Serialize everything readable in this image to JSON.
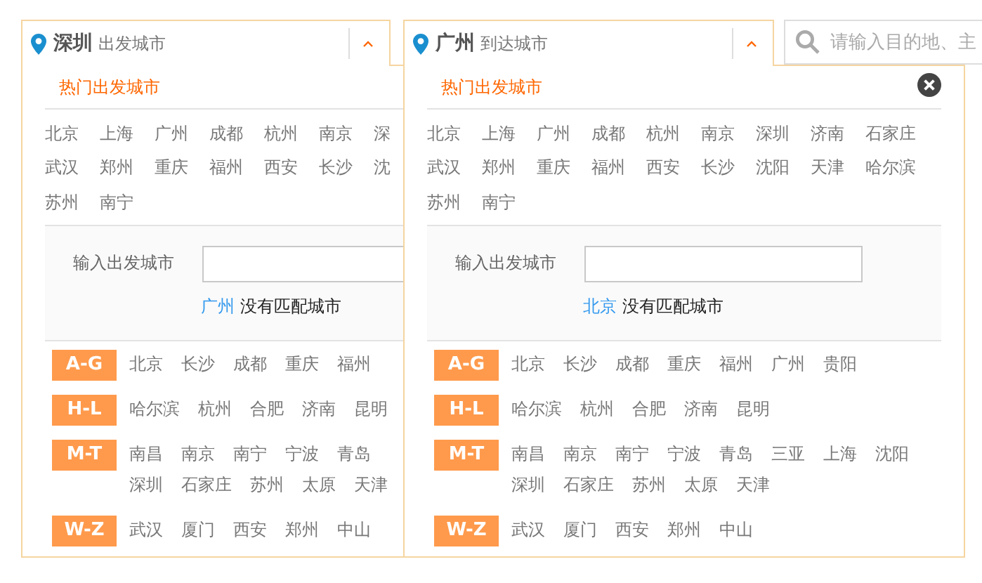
{
  "panels": [
    {
      "city": "深圳",
      "label": "出发城市",
      "expanded": true,
      "close_button": false,
      "hot_title": "热门出发城市",
      "hot_rows": [
        [
          "北京",
          "上海",
          "广州",
          "成都",
          "杭州",
          "南京",
          "深"
        ],
        [
          "武汉",
          "郑州",
          "重庆",
          "福州",
          "西安",
          "长沙",
          "沈"
        ],
        [
          "苏州",
          "南宁"
        ]
      ],
      "input_label": "输入出发城市",
      "no_match": {
        "city": "广州",
        "text": "没有匹配城市"
      },
      "groups": [
        {
          "range": "A-G",
          "lines": [
            [
              "北京",
              "长沙",
              "成都",
              "重庆",
              "福州"
            ]
          ]
        },
        {
          "range": "H-L",
          "lines": [
            [
              "哈尔滨",
              "杭州",
              "合肥",
              "济南",
              "昆明"
            ]
          ]
        },
        {
          "range": "M-T",
          "lines": [
            [
              "南昌",
              "南京",
              "南宁",
              "宁波",
              "青岛"
            ],
            [
              "深圳",
              "石家庄",
              "苏州",
              "太原",
              "天津"
            ]
          ]
        },
        {
          "range": "W-Z",
          "lines": [
            [
              "武汉",
              "厦门",
              "西安",
              "郑州",
              "中山"
            ]
          ]
        }
      ]
    },
    {
      "city": "广州",
      "label": "到达城市",
      "expanded": true,
      "close_button": true,
      "hot_title": "热门出发城市",
      "hot_rows": [
        [
          "北京",
          "上海",
          "广州",
          "成都",
          "杭州",
          "南京",
          "深圳",
          "济南",
          "石家庄"
        ],
        [
          "武汉",
          "郑州",
          "重庆",
          "福州",
          "西安",
          "长沙",
          "沈阳",
          "天津",
          "哈尔滨"
        ],
        [
          "苏州",
          "南宁"
        ]
      ],
      "input_label": "输入出发城市",
      "no_match": {
        "city": "北京",
        "text": "没有匹配城市"
      },
      "groups": [
        {
          "range": "A-G",
          "lines": [
            [
              "北京",
              "长沙",
              "成都",
              "重庆",
              "福州",
              "广州",
              "贵阳"
            ]
          ]
        },
        {
          "range": "H-L",
          "lines": [
            [
              "哈尔滨",
              "杭州",
              "合肥",
              "济南",
              "昆明"
            ]
          ]
        },
        {
          "range": "M-T",
          "lines": [
            [
              "南昌",
              "南京",
              "南宁",
              "宁波",
              "青岛",
              "三亚",
              "上海",
              "沈阳"
            ],
            [
              "深圳",
              "石家庄",
              "苏州",
              "太原",
              "天津"
            ]
          ]
        },
        {
          "range": "W-Z",
          "lines": [
            [
              "武汉",
              "厦门",
              "西安",
              "郑州",
              "中山"
            ]
          ]
        }
      ]
    }
  ],
  "search": {
    "placeholder": "请输入目的地、主"
  }
}
